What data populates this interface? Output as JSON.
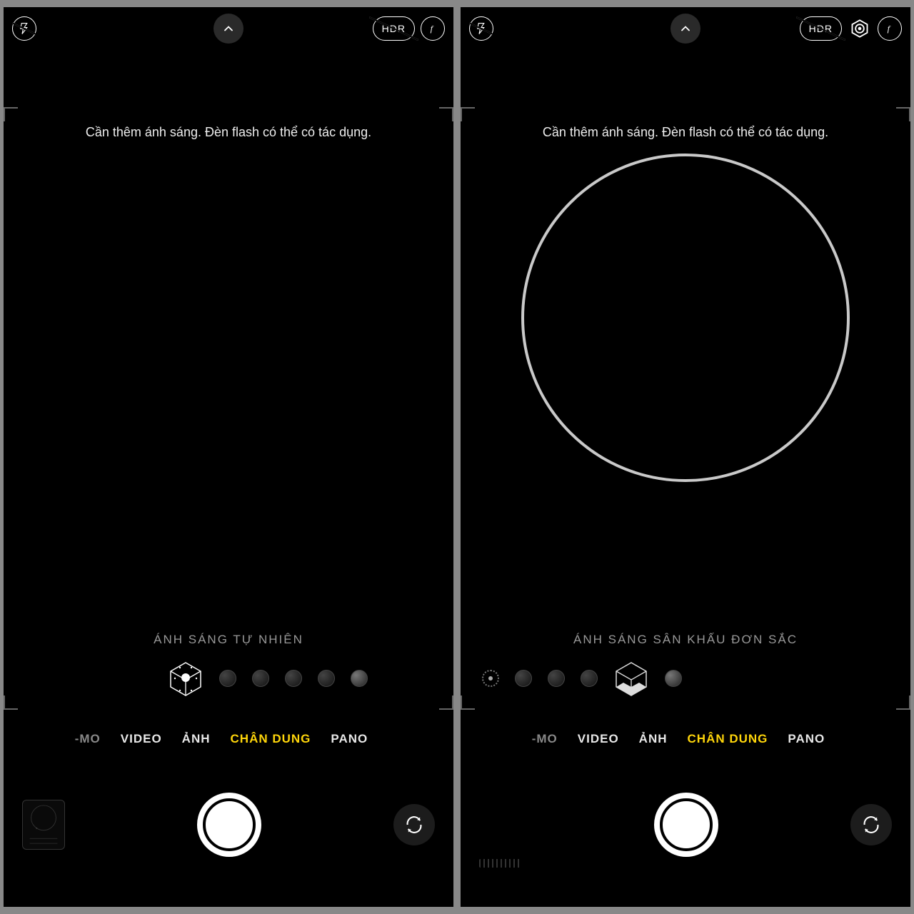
{
  "left": {
    "hint": "Cần thêm ánh sáng. Đèn flash có thể có tác dụng.",
    "lighting_name": "ÁNH SÁNG TỰ NHIÊN",
    "hdr_label": "HDR",
    "modes": {
      "cut": "-MO",
      "m0": "VIDEO",
      "m1": "ẢNH",
      "m2_active": "CHÂN DUNG",
      "m3": "PANO"
    }
  },
  "right": {
    "hint": "Cần thêm ánh sáng. Đèn flash có thể có tác dụng.",
    "lighting_name": "ÁNH SÁNG SÂN KHẤU ĐƠN SẮC",
    "hdr_label": "HDR",
    "modes": {
      "cut": "-MO",
      "m0": "VIDEO",
      "m1": "ẢNH",
      "m2_active": "CHÂN DUNG",
      "m3": "PANO"
    }
  }
}
